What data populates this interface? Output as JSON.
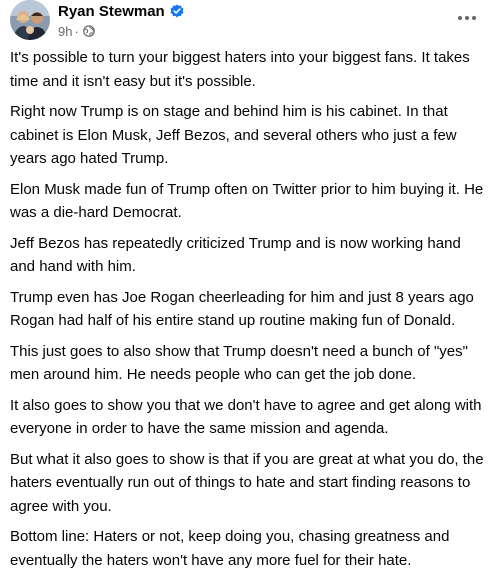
{
  "post": {
    "author": "Ryan Stewman",
    "time": "9h",
    "separator": "·",
    "icons": {
      "verified": "verified-badge-icon",
      "audience": "globe-icon",
      "more": "more-options-icon",
      "avatar": "profile-photo"
    },
    "colors": {
      "verified": "#1877f2",
      "meta_text": "#65676b",
      "body_text": "#050505"
    },
    "paragraphs": [
      "It's possible to turn your biggest haters into your biggest fans. It takes time and it isn't easy but it's possible.",
      "Right now Trump is on stage and behind him is his cabinet. In that cabinet is Elon Musk, Jeff Bezos, and several others who just a few years ago hated Trump.",
      "Elon Musk made fun of Trump often on Twitter prior to him buying it. He was a die-hard Democrat.",
      "Jeff Bezos has repeatedly criticized Trump and is now working hand and hand with him.",
      "Trump even has Joe Rogan cheerleading for him and just 8 years ago Rogan had half of his entire stand up routine making fun of Donald.",
      "This just goes to also show that Trump doesn't need a bunch of \"yes\" men around him. He needs people who can get the job done.",
      "It also goes to show you that we don't have to agree and get along with everyone in order to have the same mission and agenda.",
      "But what it also goes to show is that if you are great at what you do, the haters eventually run out of things to hate and start finding reasons to agree with you.",
      "Bottom line: Haters or not, keep doing you, chasing greatness and eventually the haters won't have any more fuel for their hate."
    ]
  }
}
